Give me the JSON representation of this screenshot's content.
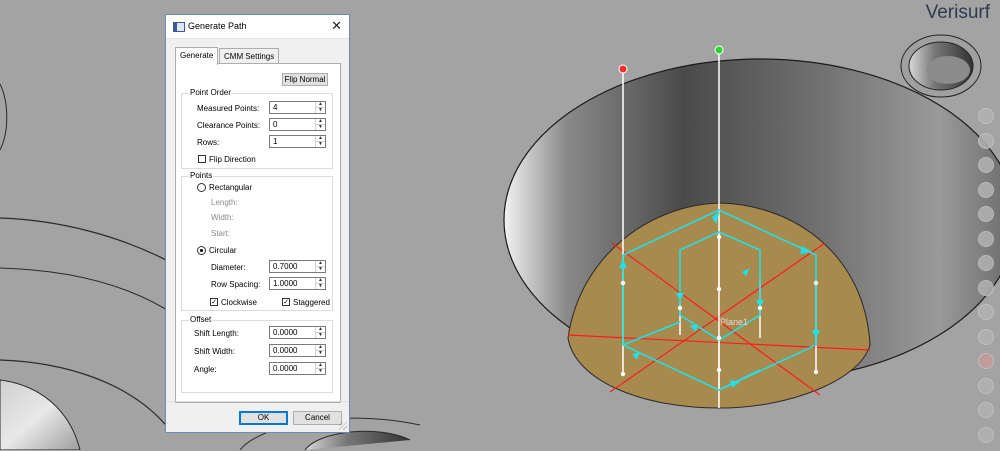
{
  "app": {
    "brand": "Verisurf"
  },
  "dialog": {
    "title": "Generate Path",
    "tabs": [
      {
        "label": "Generate",
        "active": true
      },
      {
        "label": "CMM Settings",
        "active": false
      }
    ],
    "flip_normal_label": "Flip Normal",
    "point_order": {
      "title": "Point Order",
      "measured_points": {
        "label": "Measured Points:",
        "value": "4"
      },
      "clearance_points": {
        "label": "Clearance Points:",
        "value": "0"
      },
      "rows": {
        "label": "Rows:",
        "value": "1"
      },
      "flip_direction": {
        "label": "Flip Direction",
        "checked": false
      }
    },
    "points": {
      "title": "Points",
      "rectangular": {
        "label": "Rectangular",
        "selected": false
      },
      "length_label": "Length:",
      "width_label": "Width:",
      "start_label": "Start:",
      "circular": {
        "label": "Circular",
        "selected": true
      },
      "diameter": {
        "label": "Diameter:",
        "value": "0.7000"
      },
      "row_spacing": {
        "label": "Row Spacing:",
        "value": "1.0000"
      },
      "clockwise": {
        "label": "Clockwise",
        "checked": true
      },
      "staggered": {
        "label": "Staggered",
        "checked": true
      }
    },
    "offset": {
      "title": "Offset",
      "shift_length": {
        "label": "Shift Length:",
        "value": "0.0000"
      },
      "shift_width": {
        "label": "Shift Width:",
        "value": "0.0000"
      },
      "angle": {
        "label": "Angle:",
        "value": "0.0000"
      }
    },
    "ok_label": "OK",
    "cancel_label": "Cancel"
  },
  "viewport": {
    "plane_label": "Plane1",
    "colors": {
      "background": "#a3a3a3",
      "plane_fill": "#a88a4f",
      "path": "#22e0e6",
      "section_lines": "#ff1a1a",
      "probe_start": "#ff2a2a",
      "probe_end": "#2ad62a"
    }
  }
}
